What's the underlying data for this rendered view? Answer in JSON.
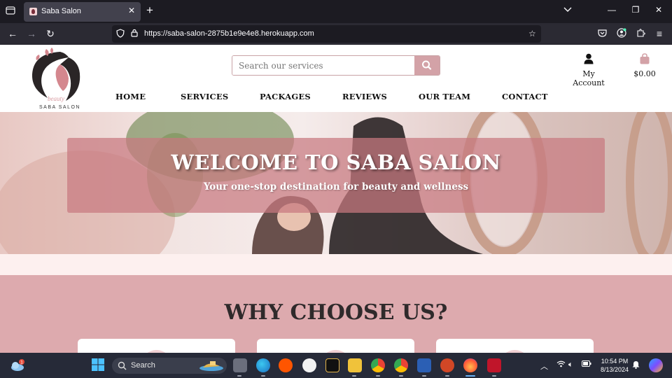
{
  "browser": {
    "tab_title": "Saba Salon",
    "url": "https://saba-salon-2875b1e9e4e8.herokuapp.com",
    "icons": {
      "tab_list": "tab-list-icon",
      "close_tab": "close-icon",
      "new_tab": "plus-icon",
      "back": "arrow-left-icon",
      "forward": "arrow-right-icon",
      "reload": "reload-icon",
      "tracking": "shield-icon",
      "lock": "lock-icon",
      "bookmark": "star-icon",
      "pocket": "pocket-icon",
      "account": "account-icon",
      "extensions": "puzzle-icon",
      "menu": "hamburger-icon"
    }
  },
  "site": {
    "logo": {
      "script_text": "beauty",
      "brand_text": "SABA SALON"
    },
    "search": {
      "placeholder": "Search our services"
    },
    "account": {
      "label": "My Account"
    },
    "cart": {
      "label": "$0.00"
    },
    "menu": [
      "HOME",
      "SERVICES",
      "PACKAGES",
      "REVIEWS",
      "OUR TEAM",
      "CONTACT"
    ],
    "hero": {
      "title": "WELCOME TO SABA SALON",
      "subtitle": "Your one-stop destination for beauty and wellness"
    },
    "why": {
      "title": "WHY CHOOSE US?"
    },
    "colors": {
      "accent": "#d3a2a7",
      "section_bg": "#ddaaae",
      "strip_bg": "#fdf0ef"
    }
  },
  "taskbar": {
    "search_label": "Search",
    "time": "10:54 PM",
    "date": "8/13/2024",
    "weather_badge": "1"
  }
}
